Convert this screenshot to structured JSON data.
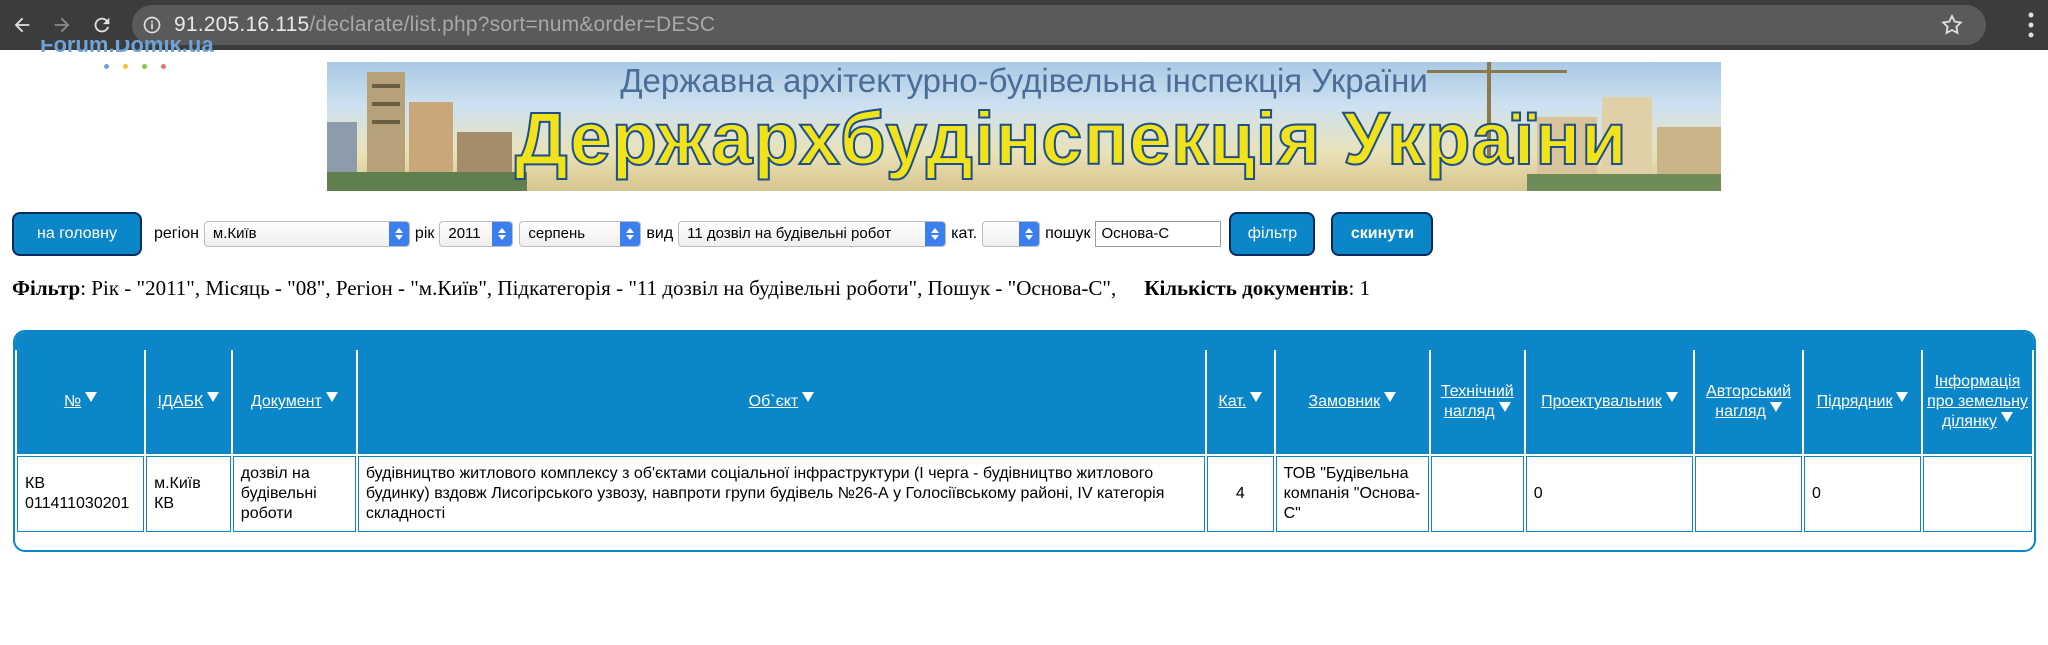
{
  "browser": {
    "url_host": "91.205.16.115",
    "url_path": "/declarate/list.php?sort=num&order=DESC"
  },
  "logo": {
    "text": "Forum.Domik.ua"
  },
  "banner": {
    "subtitle": "Державна архітектурно-будівельна інспекція України",
    "title": "Держархбудінспекція України"
  },
  "filters": {
    "home_button": "на головну",
    "region_label": "регіон",
    "region_value": "м.Київ",
    "year_label": "рік",
    "year_value": "2011",
    "month_value": "серпень",
    "type_label": "вид",
    "type_value": "11 дозвіл на будівельні робот",
    "category_label": "кат.",
    "category_value": "",
    "search_label": "пошук",
    "search_value": "Основа-С",
    "filter_button": "фільтр",
    "reset_button": "скинути"
  },
  "summary": {
    "filter_label": "Фільтр",
    "filter_text": ": Рік - \"2011\", Місяць - \"08\", Регіон - \"м.Київ\", Підкатегорія - \"11 дозвіл на будівельні роботи\", Пошук - \"Основа-С\",",
    "count_label": "Кількість документів",
    "count_value": ": 1"
  },
  "table": {
    "headers": [
      "№",
      "ІДАБК",
      "Документ",
      "Об`єкт",
      "Кат.",
      "Замовник",
      "Технічний нагляд",
      "Проектувальник",
      "Авторський нагляд",
      "Підрядник",
      "Інформація про земельну ділянку"
    ],
    "rows": [
      {
        "num": "КВ 011411030201",
        "idabk": "м.Київ КВ",
        "document": "дозвіл на будівельні роботи",
        "object": "будівництво житлового комплексу з об'єктами соціальної інфраструктури (І черга - будівництво житлового будинку) вздовж Лисогірського узвозу, навпроти групи будівель №26-А у Голосіївському районі, IV категорія складності",
        "category": "4",
        "customer": "ТОВ \"Будівельна компанія \"Основа-С\"",
        "tech_supervision": "",
        "designer": "0",
        "author_supervision": "",
        "contractor": "0",
        "land_info": ""
      }
    ]
  },
  "colors": {
    "primary": "#0a86c9",
    "button_border": "#0b2a5c",
    "chrome_bg": "#3c3c3c",
    "banner_title": "#f2e21a"
  }
}
